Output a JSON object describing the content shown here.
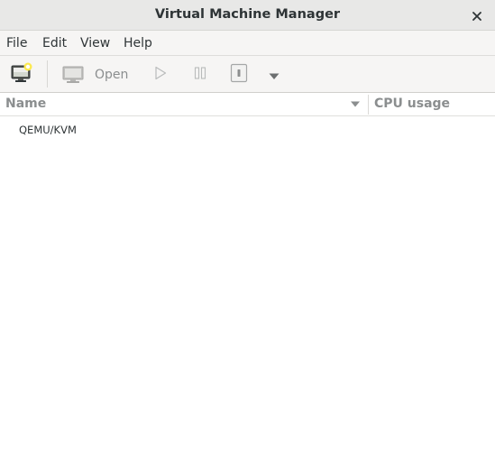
{
  "window": {
    "title": "Virtual Machine Manager",
    "close_icon": "close-icon"
  },
  "menubar": {
    "items": [
      {
        "label": "File"
      },
      {
        "label": "Edit"
      },
      {
        "label": "View"
      },
      {
        "label": "Help"
      }
    ]
  },
  "toolbar": {
    "new_vm_icon": "new-vm-icon",
    "open_icon": "monitor-icon",
    "open_label": "Open",
    "run_icon": "play-icon",
    "pause_icon": "pause-icon",
    "shutdown_icon": "shutdown-icon",
    "more_icon": "chevron-down-icon"
  },
  "columns": {
    "name": "Name",
    "cpu": "CPU usage",
    "sort_icon": "sort-arrow-down-icon"
  },
  "connections": [
    {
      "label": "QEMU/KVM"
    }
  ],
  "colors": {
    "titlebar_bg": "#e8e8e7",
    "toolbar_bg": "#f6f5f4",
    "text": "#2e3436",
    "disabled_text": "#8b8e8f"
  }
}
